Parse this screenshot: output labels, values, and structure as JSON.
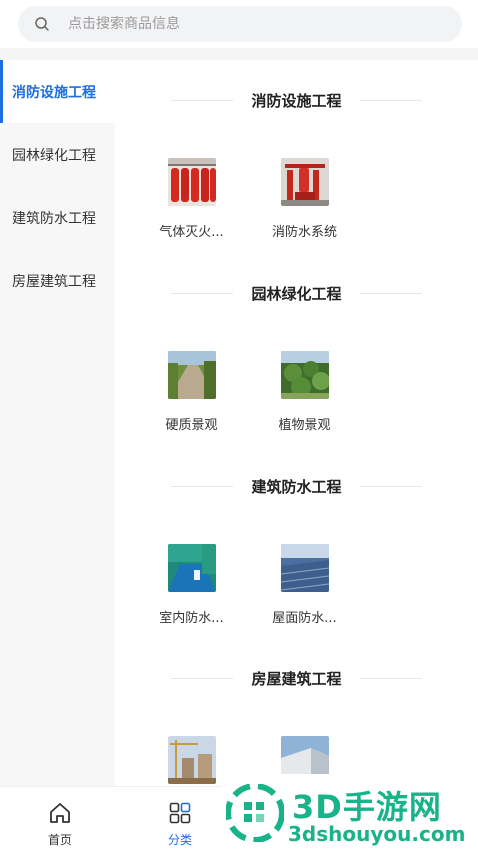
{
  "search": {
    "placeholder": "点击搜索商品信息"
  },
  "sidebar": {
    "items": [
      {
        "label": "消防设施工程",
        "active": true
      },
      {
        "label": "园林绿化工程",
        "active": false
      },
      {
        "label": "建筑防水工程",
        "active": false
      },
      {
        "label": "房屋建筑工程",
        "active": false
      }
    ]
  },
  "sections": [
    {
      "title": "消防设施工程",
      "items": [
        {
          "label": "气体灭火...",
          "icon": "gas-extinguisher-photo"
        },
        {
          "label": "消防水系统",
          "icon": "fire-water-system-photo"
        }
      ]
    },
    {
      "title": "园林绿化工程",
      "items": [
        {
          "label": "硬质景观",
          "icon": "hardscape-photo"
        },
        {
          "label": "植物景观",
          "icon": "plant-landscape-photo"
        }
      ]
    },
    {
      "title": "建筑防水工程",
      "items": [
        {
          "label": "室内防水...",
          "icon": "indoor-waterproof-photo"
        },
        {
          "label": "屋面防水...",
          "icon": "roof-waterproof-photo"
        }
      ]
    },
    {
      "title": "房屋建筑工程",
      "items": [
        {
          "label": "",
          "icon": "construction-site-photo"
        },
        {
          "label": "",
          "icon": "building-facade-photo"
        }
      ]
    }
  ],
  "tabbar": {
    "home_label": "首页",
    "category_label": "分类"
  },
  "watermark": {
    "brand": "3D手游网",
    "url": "3dshouyou.com"
  },
  "colors": {
    "accent": "#1d6fe0",
    "watermark": "#19b38a"
  }
}
